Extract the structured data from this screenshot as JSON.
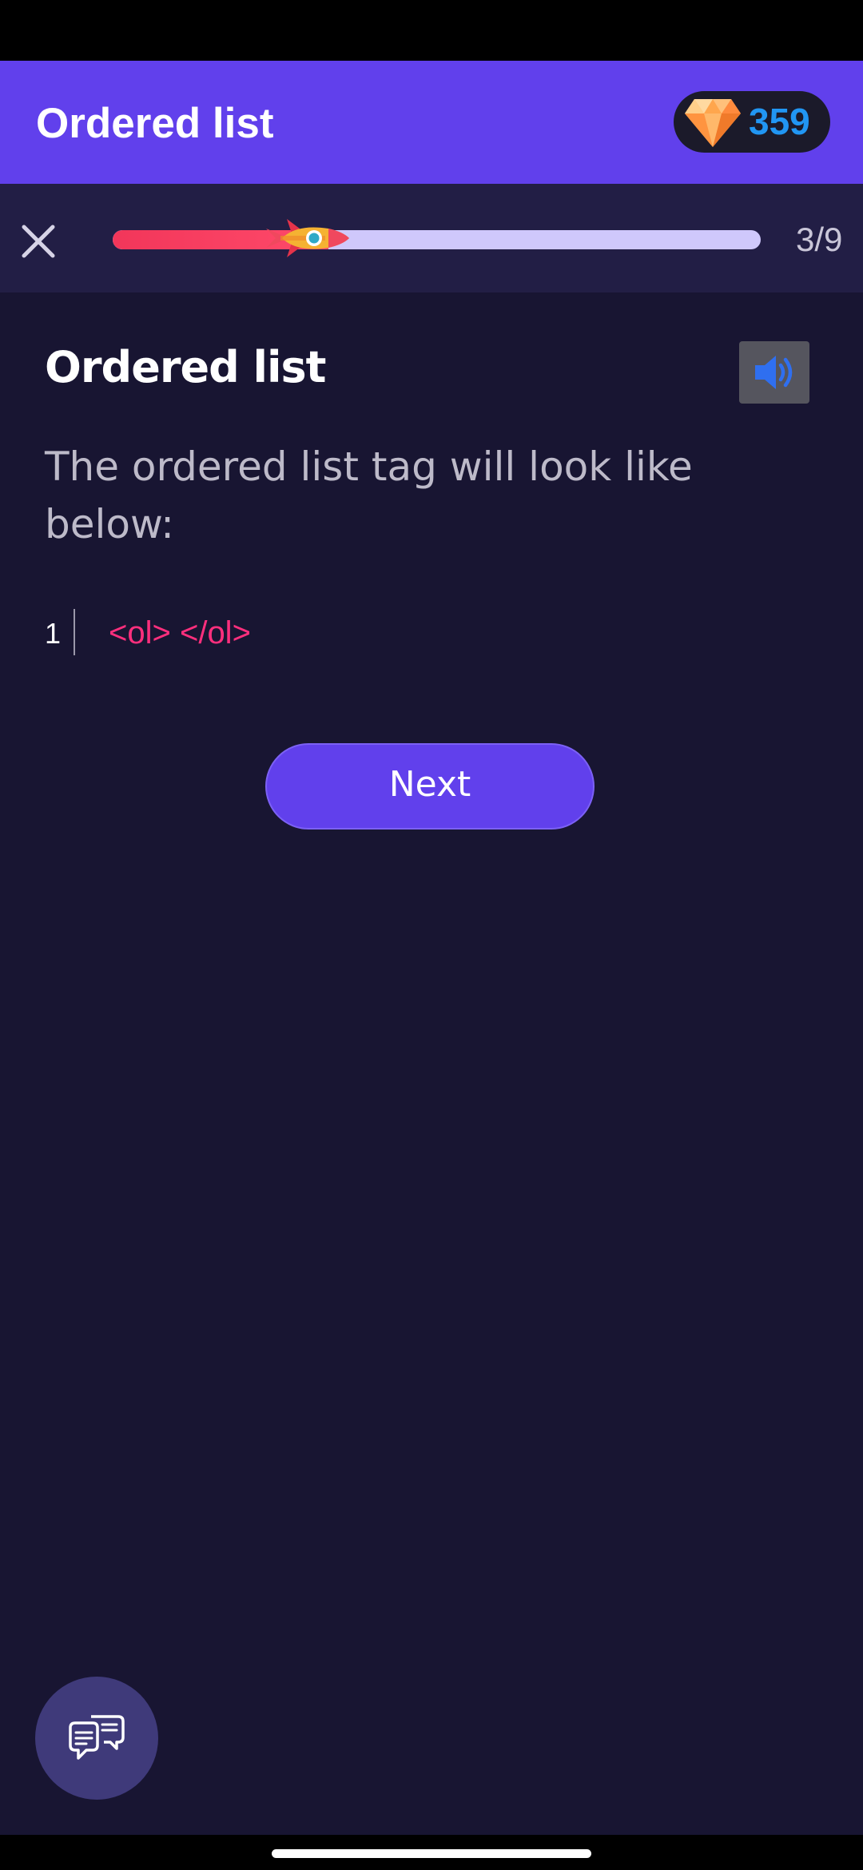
{
  "header": {
    "title": "Ordered list",
    "gem_count": "359",
    "gem_icon": "diamond-icon"
  },
  "progress": {
    "current": 3,
    "total": 9,
    "label": "3/9",
    "fraction": 0.333,
    "close_icon": "close-icon",
    "marker_icon": "rocket-icon",
    "fill_color": "#f2365a",
    "track_color": "#cfc8fb"
  },
  "lesson": {
    "title": "Ordered list",
    "sound_icon": "speaker-icon",
    "body": "The ordered list tag will look like below:",
    "code": {
      "line_number": "1",
      "text": "<ol> </ol>",
      "color": "#ff2f7d"
    },
    "next_label": "Next"
  },
  "fab": {
    "icon": "chat-bubbles-icon"
  },
  "colors": {
    "accent": "#6140ec",
    "background": "#181532",
    "gem_count": "#2196f3"
  }
}
